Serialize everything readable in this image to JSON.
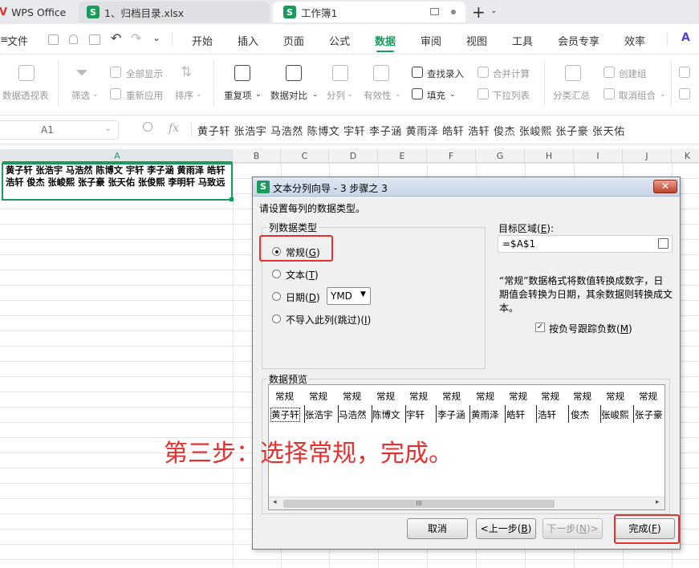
{
  "tabs": [
    {
      "label": "WPS Office"
    },
    {
      "label": "1、归档目录.xlsx"
    },
    {
      "label": "工作簿1"
    }
  ],
  "file_menu": "文件",
  "menu": [
    "开始",
    "插入",
    "页面",
    "公式",
    "数据",
    "审阅",
    "视图",
    "工具",
    "会员专享",
    "效率"
  ],
  "active_menu": "数据",
  "ribbon": {
    "pivot": "数据透视表",
    "filter": "筛选",
    "show_all": "全部显示",
    "reapply": "重新应用",
    "sort": "排序",
    "duplicates": "重复项",
    "compare": "数据对比",
    "split": "分列",
    "validity": "有效性",
    "find_entry": "查找录入",
    "fill": "填充",
    "consolidate": "合并计算",
    "dropdown_list": "下拉列表",
    "subtotal": "分类汇总",
    "create_group": "创建组",
    "ungroup": "取消组合"
  },
  "formula_bar": {
    "name_box": "A1",
    "fx": "fx",
    "content": "黄子轩 张浩宇 马浩然 陈博文 宇轩 李子涵 黄雨泽 皓轩 浩轩 俊杰 张峻熙 张子豪 张天佑"
  },
  "columns": [
    "A",
    "B",
    "C",
    "D",
    "E",
    "F",
    "G",
    "H",
    "I",
    "J",
    "K"
  ],
  "cell_A1": "黄子轩 张浩宇 马浩然 陈博文 宇轩 李子涵 黄雨泽 皓轩 浩轩 俊杰 张峻熙 张子豪 张天佑 张俊熙 李明轩 马致远",
  "dialog": {
    "title": "文本分列向导 - 3 步骤之 3",
    "close": "✕",
    "prompt": "请设置每列的数据类型。",
    "group_label": "列数据类型",
    "options": {
      "general": {
        "text": "常规(",
        "key": "G",
        "end": ")"
      },
      "text": {
        "text": "文本(",
        "key": "T",
        "end": ")"
      },
      "date": {
        "text": "日期(",
        "key": "D",
        "end": ")"
      },
      "skip": {
        "text": "不导入此列(跳过)(",
        "key": "I",
        "end": ")"
      }
    },
    "date_format": "YMD",
    "target_label_pre": "目标区域(",
    "target_label_key": "E",
    "target_label_post": "):",
    "target_value": "=$A$1",
    "description_lines": [
      "“常规”数据格式将数值转换成数字，日",
      "期值会转换为日期，其余数据则转换成文",
      "本。"
    ],
    "negative_label_pre": "按负号跟踪负数(",
    "negative_label_key": "M",
    "negative_label_post": ")",
    "preview_label": "数据预览",
    "preview_headers": [
      "常规",
      "常规",
      "常规",
      "常规",
      "常规",
      "常规",
      "常规",
      "常规",
      "常规",
      "常规",
      "常规",
      "常规"
    ],
    "preview_values": [
      "黄子轩",
      "张浩宇",
      "马浩然",
      "陈博文",
      "宇轩",
      "李子涵",
      "黄雨泽",
      "皓轩",
      "浩轩",
      "俊杰",
      "张峻熙",
      "张子豪"
    ],
    "scroll_thumb": "III",
    "buttons": {
      "cancel": "取消",
      "back": {
        "pre": "<上一步(",
        "key": "B",
        "post": ")"
      },
      "next": {
        "pre": "下一步(",
        "key": "N",
        "post": ")>"
      },
      "finish": {
        "pre": "完成(",
        "key": "F",
        "post": ")"
      }
    }
  },
  "annotation": "第三步：选择常规，完成。",
  "colors": {
    "accent": "#1a9b5c",
    "highlight": "#e53030"
  }
}
